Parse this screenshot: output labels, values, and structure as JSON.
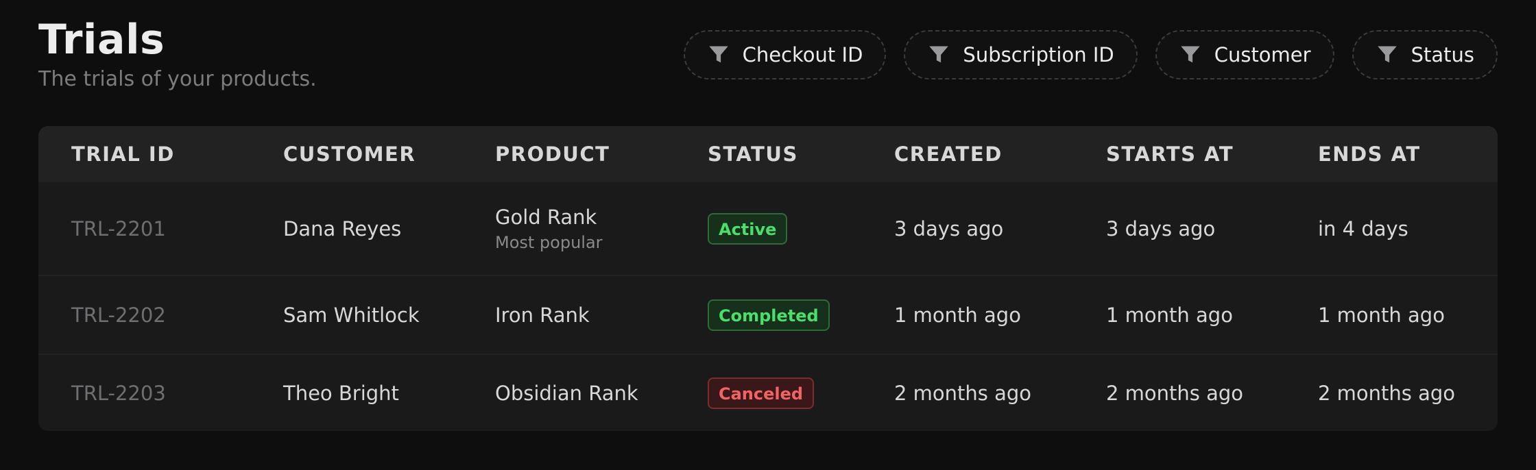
{
  "header": {
    "title": "Trials",
    "subtitle": "The trials of your products."
  },
  "filters": [
    {
      "label": "Checkout ID",
      "icon": "filter-icon"
    },
    {
      "label": "Subscription ID",
      "icon": "filter-icon"
    },
    {
      "label": "Customer",
      "icon": "filter-icon"
    },
    {
      "label": "Status",
      "icon": "filter-icon"
    }
  ],
  "table": {
    "columns": [
      "TRIAL ID",
      "CUSTOMER",
      "PRODUCT",
      "STATUS",
      "CREATED",
      "STARTS AT",
      "ENDS AT"
    ],
    "rows": [
      {
        "trial_id": "TRL-2201",
        "customer": "Dana Reyes",
        "product": "Gold Rank",
        "product_note": "Most popular",
        "status": "Active",
        "created": "3 days ago",
        "starts_at": "3 days ago",
        "ends_at": "in 4 days"
      },
      {
        "trial_id": "TRL-2202",
        "customer": "Sam Whitlock",
        "product": "Iron Rank",
        "product_note": "",
        "status": "Completed",
        "created": "1 month ago",
        "starts_at": "1 month ago",
        "ends_at": "1 month ago"
      },
      {
        "trial_id": "TRL-2203",
        "customer": "Theo Bright",
        "product": "Obsidian Rank",
        "product_note": "",
        "status": "Canceled",
        "created": "2 months ago",
        "starts_at": "2 months ago",
        "ends_at": "2 months ago"
      }
    ]
  },
  "colors": {
    "background": "#0e0e0f",
    "card": "#1a1a1b",
    "header_row": "#222223",
    "status_active": "#4ade6b",
    "status_canceled": "#f26363"
  }
}
